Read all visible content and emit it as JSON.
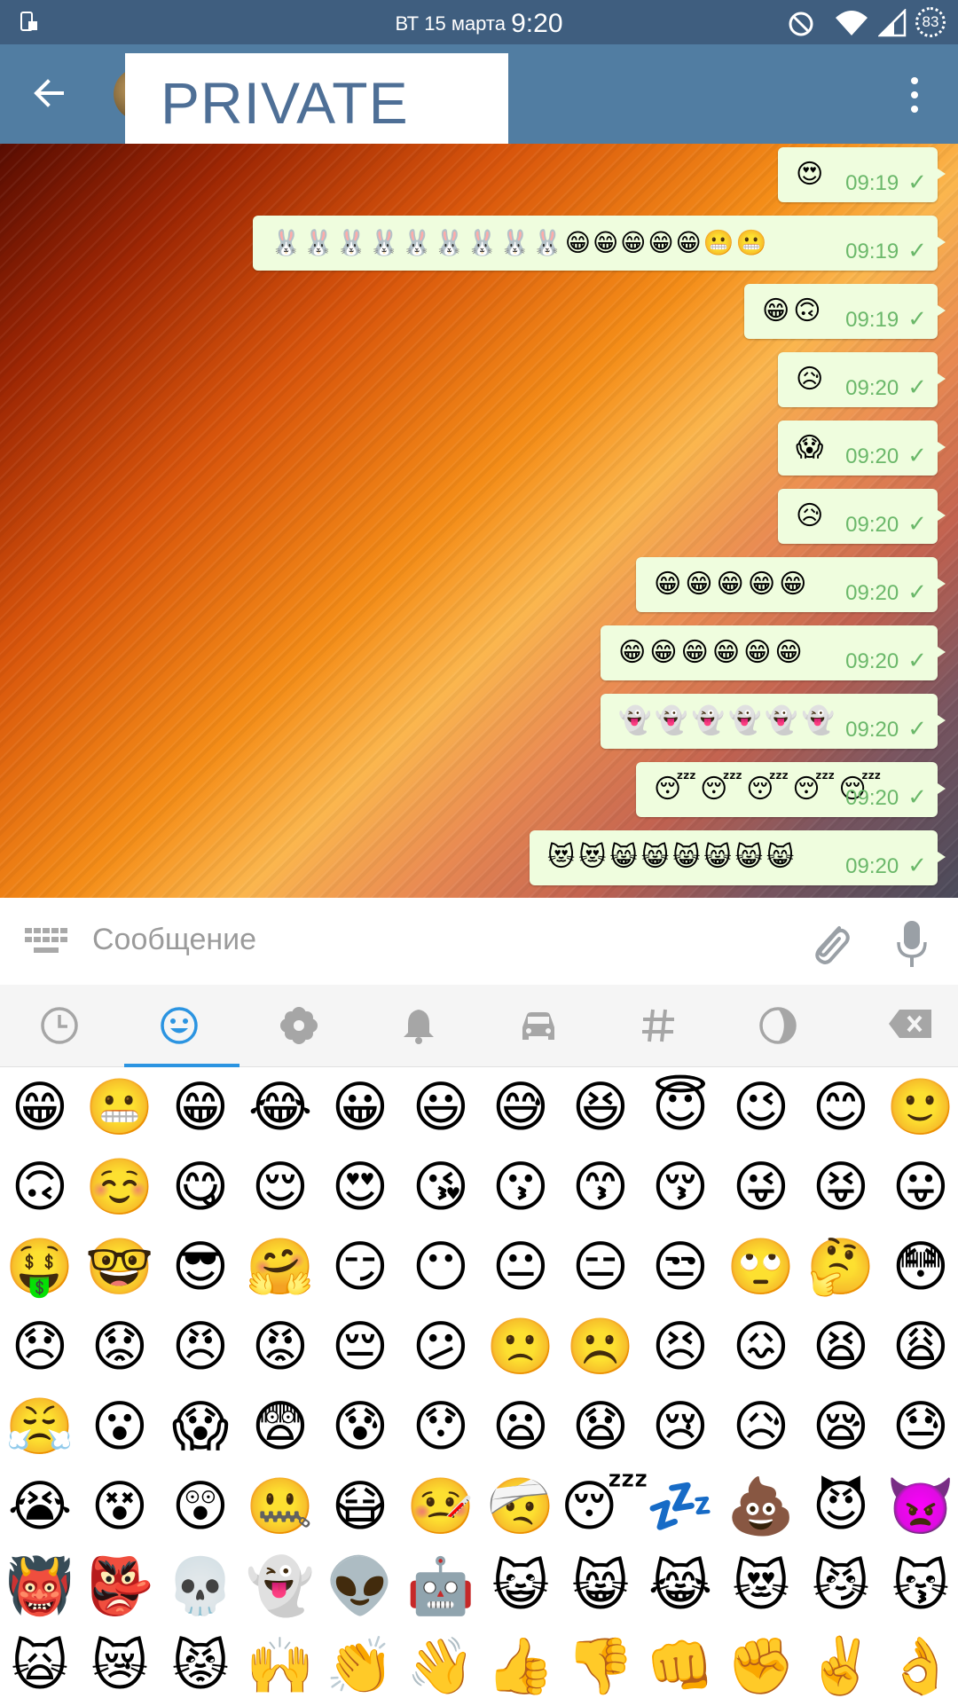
{
  "status_bar": {
    "date": "ВТ 15 марта",
    "time": "9:20",
    "battery": "83"
  },
  "app_bar": {
    "title": "PRIVATE"
  },
  "messages": [
    {
      "emojis": "😍",
      "time": "09:19"
    },
    {
      "emojis": "🐰🐰🐰🐰🐰🐰🐰🐰🐰😁😁😁😁😁😬😬",
      "time": "09:19"
    },
    {
      "emojis": "😁🙃",
      "time": "09:19"
    },
    {
      "emojis": "😥",
      "time": "09:20"
    },
    {
      "emojis": "😱",
      "time": "09:20"
    },
    {
      "emojis": "😥",
      "time": "09:20"
    },
    {
      "emojis": "😁😁😁😁😁",
      "time": "09:20"
    },
    {
      "emojis": "😁😁😁😁😁😁",
      "time": "09:20"
    },
    {
      "emojis": "👻👻👻👻👻👻",
      "time": "09:20"
    },
    {
      "emojis": "😴😴😴😴😴",
      "time": "09:20"
    },
    {
      "emojis": "😻😻😸😸😸😸😸😸",
      "time": "09:20"
    }
  ],
  "composer": {
    "placeholder": "Сообщение"
  },
  "emoji_tabs": [
    "recent-icon",
    "smileys-icon",
    "flower-icon",
    "bell-icon",
    "car-icon",
    "symbols-icon",
    "flags-icon",
    "backspace-icon"
  ],
  "emoji_grid": [
    [
      "😁",
      "😬",
      "😁",
      "😂",
      "😀",
      "😃",
      "😅",
      "😆",
      "😇",
      "😉",
      "😊",
      "🙂"
    ],
    [
      "🙃",
      "☺️",
      "😋",
      "😌",
      "😍",
      "😘",
      "😗",
      "😙",
      "😚",
      "😜",
      "😝",
      "😛"
    ],
    [
      "🤑",
      "🤓",
      "😎",
      "🤗",
      "😏",
      "😶",
      "😐",
      "😑",
      "😒",
      "🙄",
      "🤔",
      "😳"
    ],
    [
      "😞",
      "😟",
      "😠",
      "😡",
      "😔",
      "😕",
      "🙁",
      "☹️",
      "😣",
      "😖",
      "😫",
      "😩"
    ],
    [
      "😤",
      "😮",
      "😱",
      "😨",
      "😰",
      "😯",
      "😦",
      "😧",
      "😢",
      "😥",
      "😪",
      "😓"
    ],
    [
      "😭",
      "😵",
      "😲",
      "🤐",
      "😷",
      "🤒",
      "🤕",
      "😴",
      "💤",
      "💩",
      "😈",
      "👿"
    ],
    [
      "👹",
      "👺",
      "💀",
      "👻",
      "👽",
      "🤖",
      "😺",
      "😸",
      "😹",
      "😻",
      "😼",
      "😽"
    ],
    [
      "🙀",
      "😿",
      "😾",
      "🙌",
      "👏",
      "👋",
      "👍",
      "👎",
      "👊",
      "✊",
      "✌️",
      "👌"
    ]
  ],
  "colors": {
    "status_bar": "#3f5e7f",
    "app_bar": "#517da2",
    "bubble": "#effdde",
    "meta": "#6bb86a",
    "tab_indicator": "#2b94e1"
  }
}
